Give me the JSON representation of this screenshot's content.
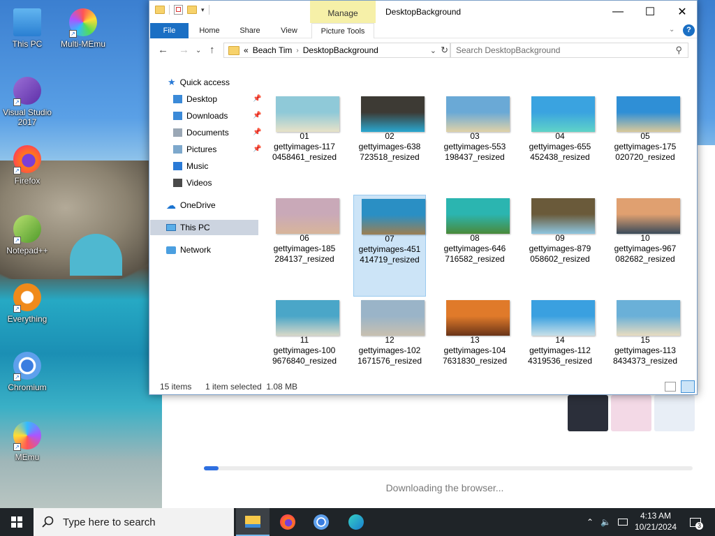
{
  "desktop": {
    "icons": [
      {
        "label": "This PC",
        "icon": "this-pc-icon"
      },
      {
        "label": "Multi-MEmu",
        "icon": "multi-memu-icon"
      },
      {
        "label": "Visual Studio\n2017",
        "icon": "visual-studio-icon"
      },
      {
        "label": "Firefox",
        "icon": "firefox-icon"
      },
      {
        "label": "Notepad++",
        "icon": "notepad-plus-plus-icon"
      },
      {
        "label": "Everything",
        "icon": "everything-icon"
      },
      {
        "label": "Chromium",
        "icon": "chromium-icon"
      },
      {
        "label": "MEmu",
        "icon": "memu-icon"
      }
    ]
  },
  "background_window": {
    "status_text": "Downloading the browser...",
    "progress": 0.03,
    "accent": "#2e6fe0"
  },
  "explorer": {
    "title": "DesktopBackground",
    "context_tab_group": "Manage",
    "ribbon_tabs": [
      "File",
      "Home",
      "Share",
      "View",
      "Picture Tools"
    ],
    "address": {
      "prefix": "«",
      "segments": [
        "Beach Tim",
        "DesktopBackground"
      ]
    },
    "search_placeholder": "Search DesktopBackground",
    "nav": {
      "quick_access": "Quick access",
      "items": [
        {
          "label": "Desktop",
          "icon": "desktop-folder-icon",
          "pinned": true
        },
        {
          "label": "Downloads",
          "icon": "downloads-folder-icon",
          "pinned": true
        },
        {
          "label": "Documents",
          "icon": "documents-folder-icon",
          "pinned": true
        },
        {
          "label": "Pictures",
          "icon": "pictures-folder-icon",
          "pinned": true
        },
        {
          "label": "Music",
          "icon": "music-folder-icon",
          "pinned": false
        },
        {
          "label": "Videos",
          "icon": "videos-folder-icon",
          "pinned": false
        }
      ],
      "onedrive": "OneDrive",
      "this_pc": "This PC",
      "network": "Network"
    },
    "files": [
      {
        "name": "01\ngettyimages-117\n0458461_resized",
        "colors": [
          "#8fc9d8",
          "#e8e2c8"
        ]
      },
      {
        "name": "02\ngettyimages-638\n723518_resized",
        "colors": [
          "#3d3a34",
          "#2aa8d0"
        ]
      },
      {
        "name": "03\ngettyimages-553\n198437_resized",
        "colors": [
          "#6aa9d6",
          "#e0d2a8"
        ]
      },
      {
        "name": "04\ngettyimages-655\n452438_resized",
        "colors": [
          "#3aa3e0",
          "#5fd3c8"
        ]
      },
      {
        "name": "05\ngettyimages-175\n020720_resized",
        "colors": [
          "#2f8fd6",
          "#d9c99a"
        ]
      },
      {
        "name": "06\ngettyimages-185\n284137_resized",
        "colors": [
          "#c9a9b8",
          "#d8b59a"
        ]
      },
      {
        "name": "07\ngettyimages-451\n414719_resized",
        "colors": [
          "#2a8fc4",
          "#9c7f52"
        ]
      },
      {
        "name": "08\ngettyimages-646\n716582_resized",
        "colors": [
          "#2bb5b0",
          "#4a8a3a"
        ]
      },
      {
        "name": "09\ngettyimages-879\n058602_resized",
        "colors": [
          "#6a5a3a",
          "#8ec6e0"
        ]
      },
      {
        "name": "10\ngettyimages-967\n082682_resized",
        "colors": [
          "#e0a070",
          "#3a4a5a"
        ]
      },
      {
        "name": "11\ngettyimages-100\n9676840_resized",
        "colors": [
          "#4aa6c8",
          "#d8d8c8"
        ]
      },
      {
        "name": "12\ngettyimages-102\n1671576_resized",
        "colors": [
          "#9ab4c8",
          "#c8c0b0"
        ]
      },
      {
        "name": "13\ngettyimages-104\n7631830_resized",
        "colors": [
          "#e07a2a",
          "#6a3418"
        ]
      },
      {
        "name": "14\ngettyimages-112\n4319536_resized",
        "colors": [
          "#3aa0e0",
          "#c8e0e8"
        ]
      },
      {
        "name": "15\ngettyimages-113\n8434373_resized",
        "colors": [
          "#6ab0d8",
          "#e8dcc0"
        ]
      }
    ],
    "selected_index": 6,
    "status": {
      "count": "15 items",
      "selection": "1 item selected  1.08 MB"
    }
  },
  "taskbar": {
    "search_placeholder": "Type here to search",
    "apps": [
      "file-explorer-icon",
      "firefox-icon",
      "chromium-icon",
      "memu-icon"
    ],
    "time": "4:13 AM",
    "date": "10/21/2024",
    "notification_count": "3"
  }
}
